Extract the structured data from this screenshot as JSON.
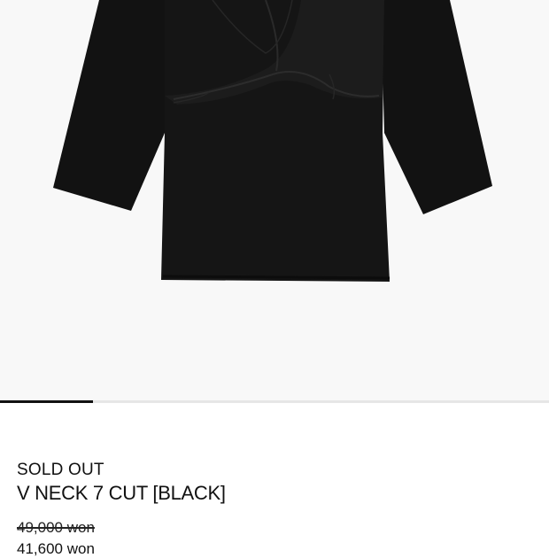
{
  "product": {
    "image": {
      "alt": "V NECK 7 CUT [BLACK]",
      "background_color": "#f8f8f8",
      "garment_color": "#111111"
    },
    "carousel": {
      "current_slide_fraction": 0.17,
      "indicator_color": "#111111",
      "track_color": "#e6e6e6"
    },
    "status": "SOLD OUT",
    "name": "V NECK 7 CUT [BLACK]",
    "original_price": "49,000 won",
    "sale_price": "41,600 won"
  }
}
